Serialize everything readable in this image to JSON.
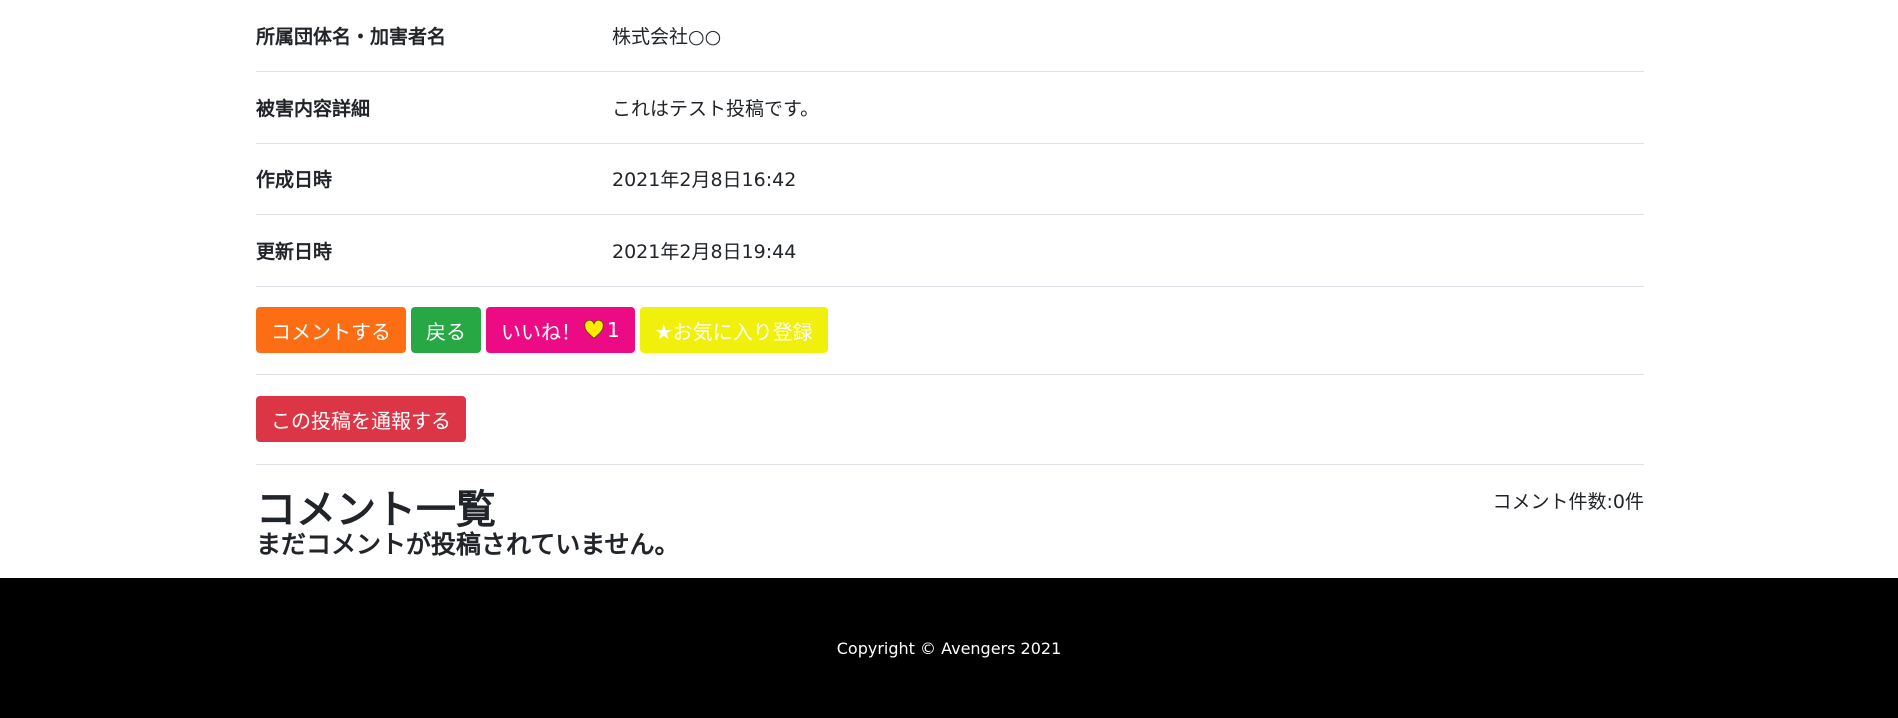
{
  "detail": {
    "rows": [
      {
        "label": "所属団体名・加害者名",
        "value": "株式会社○○"
      },
      {
        "label": "被害内容詳細",
        "value": "これはテスト投稿です。"
      },
      {
        "label": "作成日時",
        "value": "2021年2月8日16:42"
      },
      {
        "label": "更新日時",
        "value": "2021年2月8日19:44"
      }
    ]
  },
  "actions": {
    "comment_label": "コメントする",
    "back_label": "戻る",
    "like_label": "いいね！",
    "like_count": "1",
    "favorite_label": "★お気に入り登録",
    "report_label": "この投稿を通報する"
  },
  "comments": {
    "title": "コメント一覧",
    "count_text": "コメント件数:0件",
    "empty_text": "まだコメントが投稿されていません。"
  },
  "footer": {
    "copyright": "Copyright © Avengers 2021"
  },
  "colors": {
    "comment": "#fd6d14",
    "back": "#28a745",
    "like": "#ed0b85",
    "favorite": "#f0f00c",
    "report": "#dc3545",
    "heart": "#ffeb00"
  }
}
